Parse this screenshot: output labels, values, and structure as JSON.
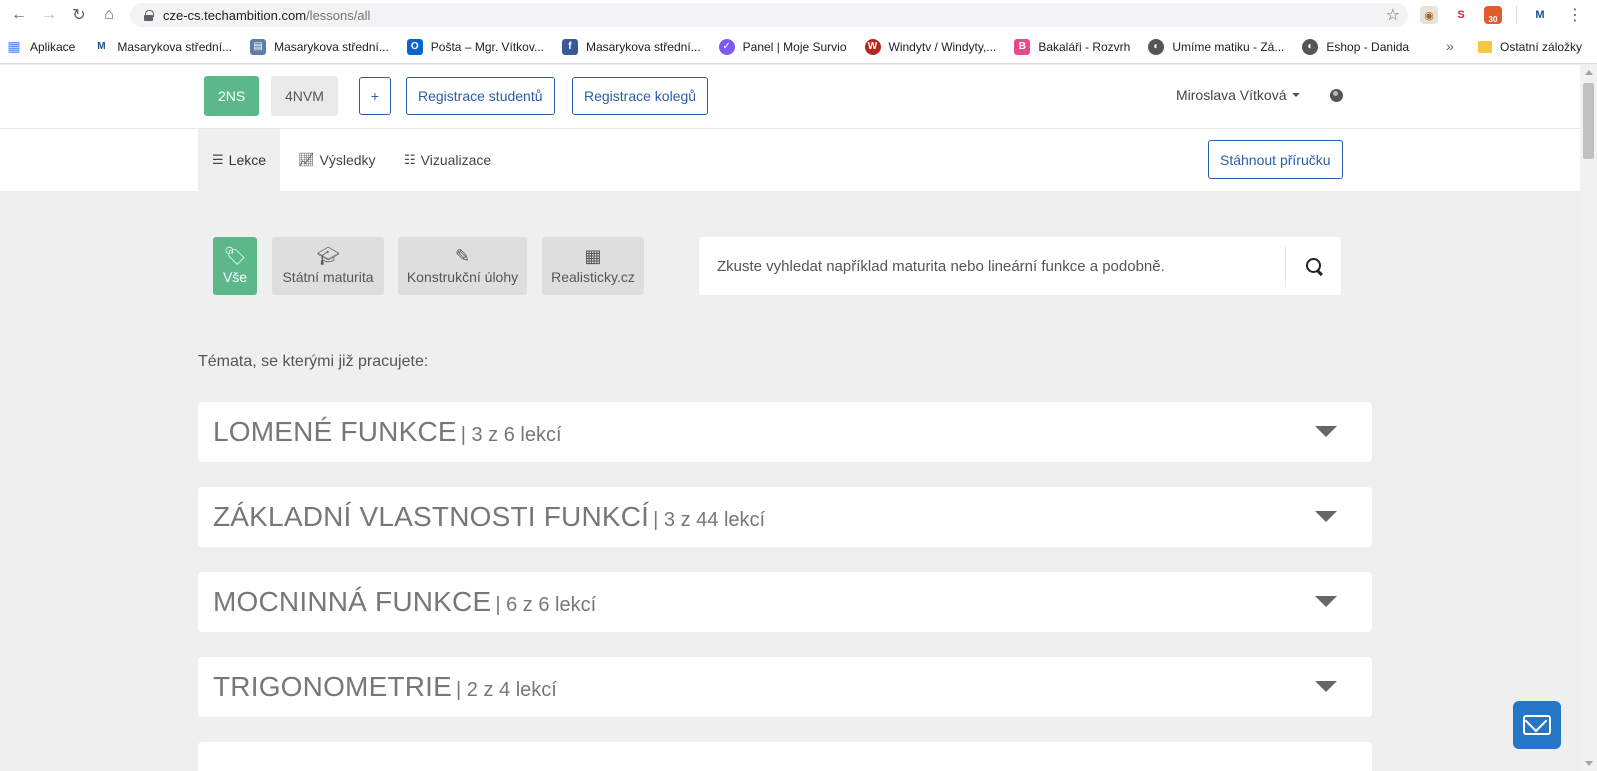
{
  "browser": {
    "url_host": "cze-cs.techambition.com",
    "url_path": "/lessons/all",
    "ext_badge": "30",
    "bookmarks": [
      {
        "label": "Aplikace",
        "color": "#4285f4",
        "glyph": "▦"
      },
      {
        "label": "Masarykova střední...",
        "color": "#1a4e8a",
        "glyph": "M"
      },
      {
        "label": "Masarykova střední...",
        "color": "#5b7fa6",
        "glyph": "▤"
      },
      {
        "label": "Pošta – Mgr. Vítkov...",
        "color": "#0a64c9",
        "glyph": "O"
      },
      {
        "label": "Masarykova střední...",
        "color": "#3b5998",
        "glyph": "f"
      },
      {
        "label": "Panel | Moje Survio",
        "color": "#7b5cf0",
        "glyph": "S"
      },
      {
        "label": "Windytv / Windyty,...",
        "color": "#b3261e",
        "glyph": "W"
      },
      {
        "label": "Bakaláři - Rozvrh",
        "color": "#e94b8a",
        "glyph": "B"
      },
      {
        "label": "Umíme matiku - Zá...",
        "color": "#555555",
        "glyph": "◐"
      },
      {
        "label": "Eshop - Danida",
        "color": "#555555",
        "glyph": "◐"
      }
    ],
    "bookmarks_more": "»",
    "other_bookmarks": "Ostatní záložky"
  },
  "topbar": {
    "classes": [
      "2NS",
      "4NVM"
    ],
    "add_label": "+",
    "register_students": "Registrace studentů",
    "register_colleagues": "Registrace kolegů",
    "user_name": "Miroslava Vítková"
  },
  "subnav": {
    "tabs": [
      {
        "label": "Lekce",
        "icon": "list-icon"
      },
      {
        "label": "Výsledky",
        "icon": "chart-icon"
      },
      {
        "label": "Vizualizace",
        "icon": "sliders-icon"
      }
    ],
    "download_label": "Stáhnout příručku"
  },
  "filters": [
    {
      "label": "Vše",
      "icon": "tags-icon"
    },
    {
      "label": "Státní maturita",
      "icon": "graduation-cap-icon"
    },
    {
      "label": "Konstrukční úlohy",
      "icon": "edit-icon"
    },
    {
      "label": "Realisticky.cz",
      "icon": "calculator-icon"
    }
  ],
  "search": {
    "placeholder": "Zkuste vyhledat například maturita nebo lineární funkce a podobně."
  },
  "section_label": "Témata, se kterými již pracujete:",
  "topics": [
    {
      "title": "LOMENÉ FUNKCE",
      "count": "| 3 z 6 lekcí"
    },
    {
      "title": "ZÁKLADNÍ VLASTNOSTI FUNKCÍ",
      "count": "| 3 z 44 lekcí"
    },
    {
      "title": "MOCNINNÁ FUNKCE",
      "count": "| 6 z 6 lekcí"
    },
    {
      "title": "TRIGONOMETRIE",
      "count": "| 2 z 4 lekcí"
    }
  ],
  "colors": {
    "accent_green": "#5cb88a",
    "accent_blue": "#2a5ea8",
    "chat_blue": "#2576c6"
  }
}
